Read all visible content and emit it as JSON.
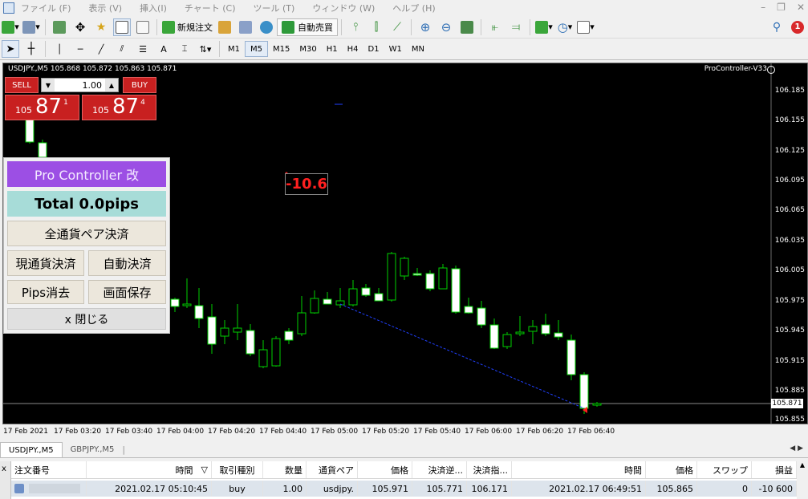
{
  "menu": [
    "ファイル (F)",
    "表示 (V)",
    "挿入(I)",
    "チャート (C)",
    "ツール (T)",
    "ウィンドウ (W)",
    "ヘルプ (H)"
  ],
  "toolbar": {
    "new_order": "新規注文",
    "auto_trade": "自動売買",
    "notification_count": "1",
    "text_tool": "A",
    "timeframes": [
      "M1",
      "M5",
      "M15",
      "M30",
      "H1",
      "H4",
      "D1",
      "W1",
      "MN"
    ],
    "active_timeframe": "M5"
  },
  "chart": {
    "title": "USDJPY.,M5  105.868 105.872 105.863 105.871",
    "ea_name": "ProController-V33",
    "price_labels": [
      "106.185",
      "106.155",
      "106.125",
      "106.095",
      "106.065",
      "106.035",
      "106.005",
      "105.975",
      "105.945",
      "105.915",
      "105.885",
      "105.855"
    ],
    "current_price": "105.871",
    "time_labels": [
      "17 Feb 2021",
      "17 Feb 03:20",
      "17 Feb 03:40",
      "17 Feb 04:00",
      "17 Feb 04:20",
      "17 Feb 04:40",
      "17 Feb 05:00",
      "17 Feb 05:20",
      "17 Feb 05:40",
      "17 Feb 06:00",
      "17 Feb 06:20",
      "17 Feb 06:40"
    ],
    "pips_label": "-10.6",
    "colors": {
      "background": "#000000",
      "bull": "#00d000",
      "bear_body": "#ffffff",
      "trade_line": "#2040ff",
      "pips": "#ff2020"
    }
  },
  "one_click": {
    "sell_label": "SELL",
    "buy_label": "BUY",
    "lot": "1.00",
    "sell_price_small": "105",
    "sell_price_big": "87",
    "sell_price_sup": "1",
    "buy_price_small": "105",
    "buy_price_big": "87",
    "buy_price_sup": "4"
  },
  "pro_controller": {
    "title": "Pro Controller 改",
    "total": "Total    0.0pips",
    "close_all": "全通貨ペア決済",
    "close_current": "現通貨決済",
    "auto_close": "自動決済",
    "clear_pips": "Pips消去",
    "save_screen": "画面保存",
    "close": "x 閉じる"
  },
  "chart_tabs": [
    "USDJPY.,M5",
    "GBPJPY.,M5"
  ],
  "terminal": {
    "headers": [
      "注文番号",
      "時間",
      "取引種別",
      "数量",
      "通貨ペア",
      "価格",
      "決済逆...",
      "決済指...",
      "時間",
      "価格",
      "スワップ",
      "損益"
    ],
    "row": [
      "",
      "2021.02.17 05:10:45",
      "buy",
      "1.00",
      "usdjpy.",
      "105.971",
      "105.771",
      "106.171",
      "2021.02.17 06:49:51",
      "105.865",
      "0",
      "-10 600"
    ],
    "sort_glyph": "▽",
    "side_close": "x"
  }
}
